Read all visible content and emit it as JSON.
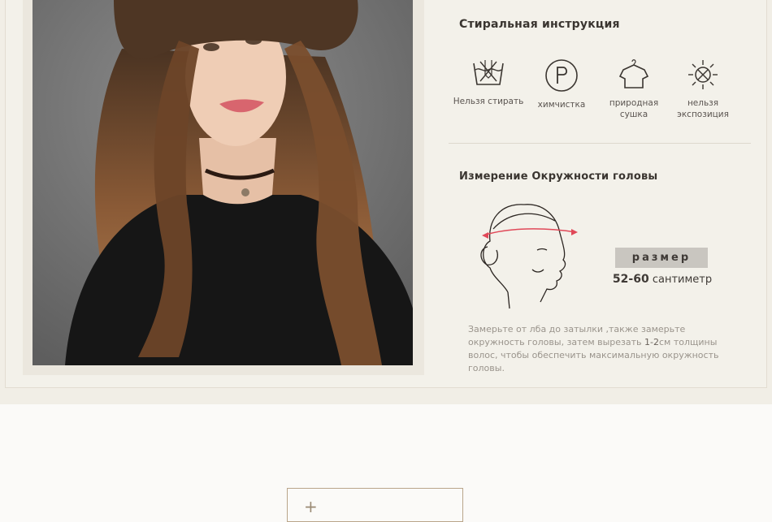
{
  "care": {
    "title": "Стиральная инструкция",
    "items": [
      {
        "icon": "no-wash-icon",
        "label": "Нельзя стирать"
      },
      {
        "icon": "dry-clean-icon",
        "label": "химчистка"
      },
      {
        "icon": "natural-dry-icon",
        "label": "природная сушка"
      },
      {
        "icon": "no-sun-exposure-icon",
        "label": "нельзя экспозиция"
      }
    ]
  },
  "measure": {
    "title": "Измерение Окружности головы",
    "size_label": "размер",
    "size_value": "52-60",
    "size_unit": "сантиметр",
    "note_part1": "Замерьте от лба до затылки ,также замерьте окружность головы, затем вырезать ",
    "note_em": "1-2",
    "note_part2": "см толщины волос, чтобы обеспечить максимальную окружность головы."
  },
  "colors": {
    "accent": "#b9a58a",
    "panel": "#f1eee6",
    "badge": "#c9c6c0"
  }
}
